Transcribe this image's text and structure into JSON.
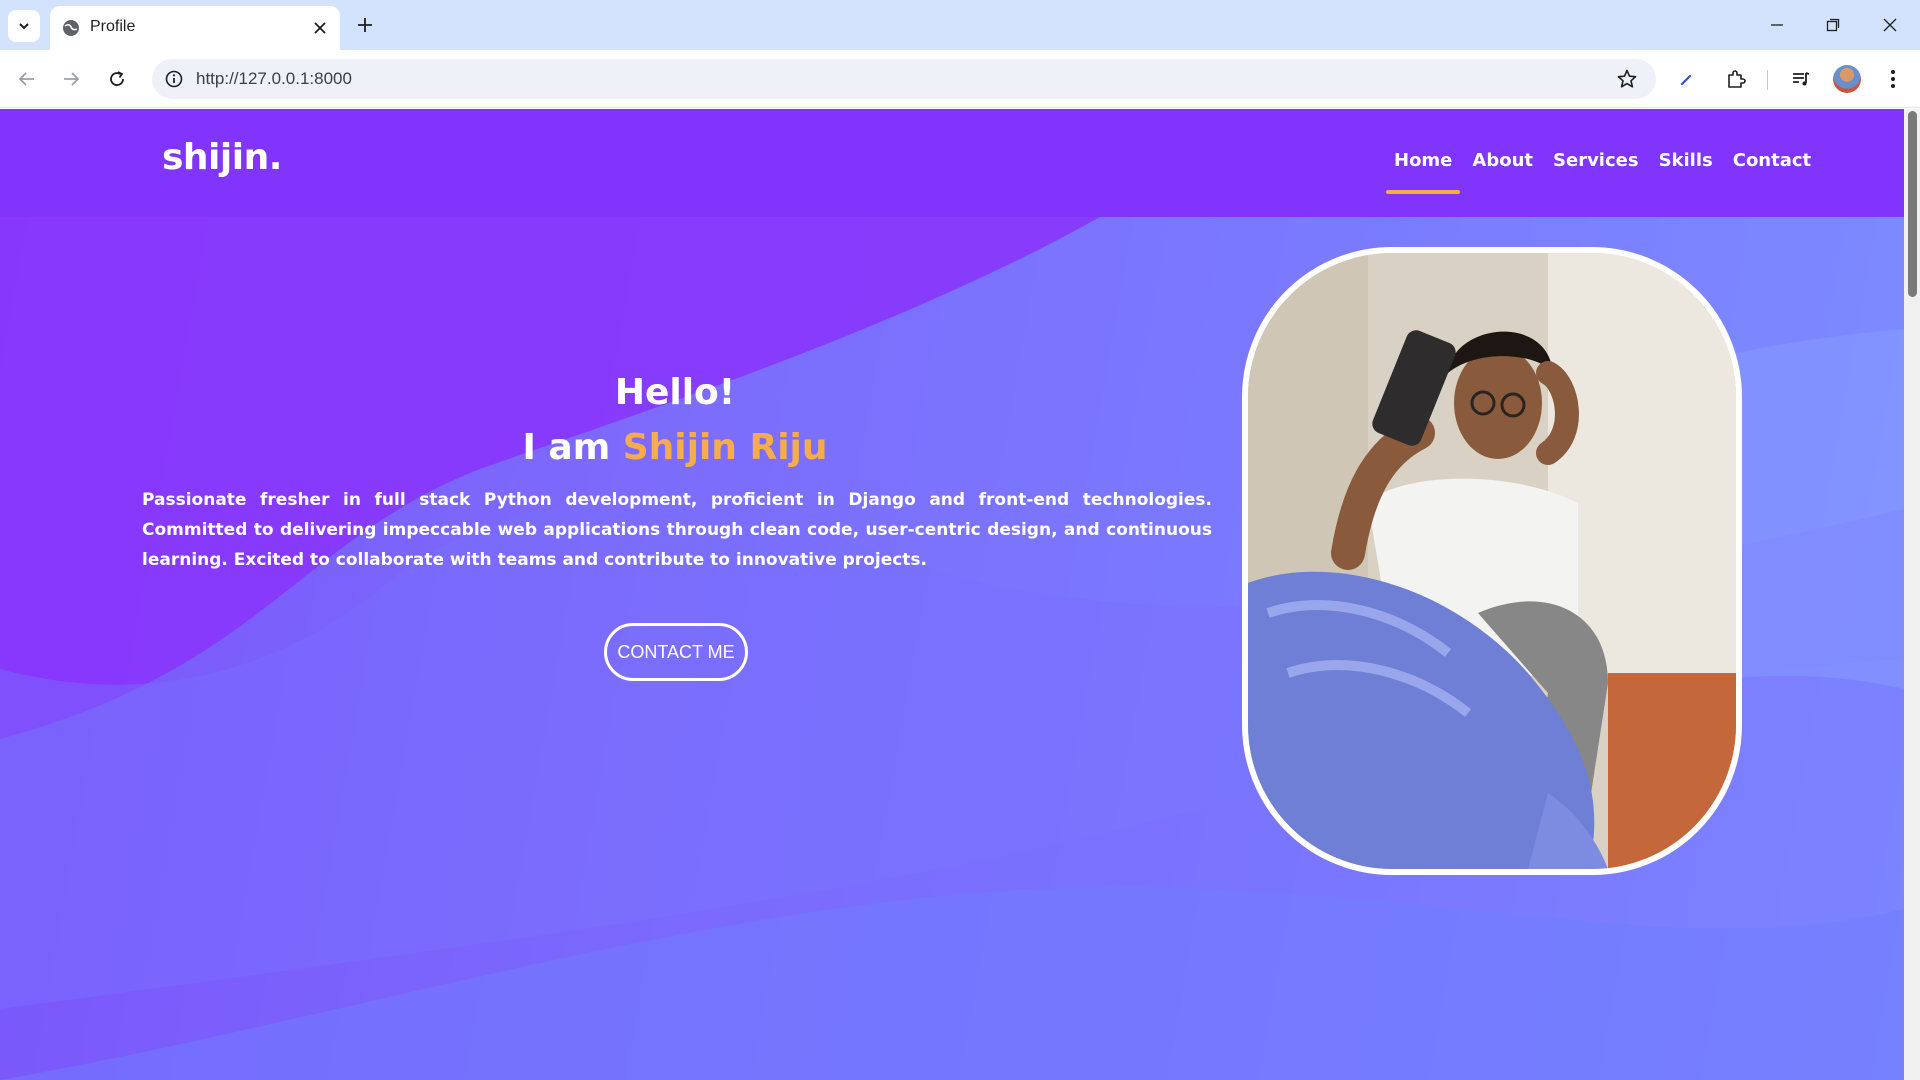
{
  "browser": {
    "tab_title": "Profile",
    "url": "http://127.0.0.1:8000",
    "icons": {
      "tab_list": "chevron-down-icon",
      "favicon": "globe-icon",
      "tab_close": "close-icon",
      "new_tab": "plus-icon",
      "minimize": "minimize-icon",
      "restore": "restore-icon",
      "close": "close-icon",
      "back": "arrow-left-icon",
      "forward": "arrow-right-icon",
      "reload": "reload-icon",
      "site_info": "info-icon",
      "bookmark": "star-icon",
      "extension_pen": "pen-icon",
      "extensions": "puzzle-icon",
      "media": "media-queue-icon",
      "menu": "kebab-menu-icon"
    }
  },
  "site": {
    "logo": "shijin.",
    "nav": [
      {
        "label": "Home",
        "active": true
      },
      {
        "label": "About",
        "active": false
      },
      {
        "label": "Services",
        "active": false
      },
      {
        "label": "Skills",
        "active": false
      },
      {
        "label": "Contact",
        "active": false
      }
    ],
    "hero": {
      "greeting": "Hello!",
      "intro_prefix": "I am ",
      "name": "Shijin Riju",
      "bio": "Passionate fresher in full stack Python development, proficient in Django and front-end technologies. Committed to delivering impeccable web applications through clean code, user-centric design, and continuous learning. Excited to collaborate with teams and contribute to innovative projects.",
      "cta_label": "CONTACT ME"
    },
    "photo": {
      "subject": "person taking a selfie with a phone, seated, wearing glasses and a white t-shirt"
    }
  },
  "colors": {
    "navbar": "#8134fb",
    "accent": "#f6ac4b",
    "hero_start": "#7b3ef7",
    "hero_end": "#7f96ff",
    "text": "#ffffff"
  }
}
